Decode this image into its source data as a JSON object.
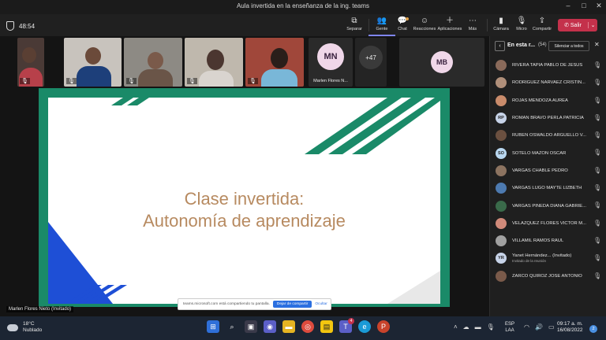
{
  "window": {
    "title": "Aula invertida en la enseñanza de la ing. teams",
    "controls": [
      "–",
      "□",
      "✕"
    ]
  },
  "meeting": {
    "timer": "48:54"
  },
  "toolbar": {
    "separar": "Separar",
    "gente": "Gente",
    "chat": "Chat",
    "reacciones": "Reacciones",
    "aplicaciones": "Aplicaciones",
    "mas": "Más",
    "camara": "Cámara",
    "micro": "Micro",
    "compartir": "Compartir",
    "salir": "Salir"
  },
  "tiles": {
    "mn_initials": "MN",
    "mn_name": "Marlen Flores N...",
    "overflow": "+47",
    "mb_initials": "MB"
  },
  "slide": {
    "title_line1": "Clase invertida:",
    "title_line2": "Autonomía de aprendizaje"
  },
  "sharebar": {
    "message": "teams.microsoft.com está compartiendo tu pantalla.",
    "stop": "Dejar de compartir",
    "hide": "Ocultar"
  },
  "presenter_label": "Marlen Flores Nieto (Invitado)",
  "panel": {
    "title": "En esta r...",
    "count": "(54)",
    "mute_all": "Silenciar a todos",
    "participants": [
      {
        "name": "RIVERA TAPIA PABLO DE JESUS",
        "initials": "",
        "color": "#8a6a5a"
      },
      {
        "name": "RODRIGUEZ NARVAEZ CRISTIN...",
        "initials": "",
        "color": "#b08f7a"
      },
      {
        "name": "ROJAS MENDOZA AUREA",
        "initials": "",
        "color": "#c98b6b"
      },
      {
        "name": "ROMAN BRAVO PERLA PATRICIA",
        "initials": "RP",
        "color": "#c7d3e8"
      },
      {
        "name": "RUBEN OSWALDO ARGUELLO V...",
        "initials": "",
        "color": "#6b5040"
      },
      {
        "name": "SOTELO MAZON OSCAR",
        "initials": "SO",
        "color": "#b9d7f0"
      },
      {
        "name": "VARGAS CHABLE PEDRO",
        "initials": "",
        "color": "#8c7360"
      },
      {
        "name": "VARGAS LUGO MAYTE LIZBETH",
        "initials": "",
        "color": "#4d7ab0"
      },
      {
        "name": "VARGAS PINEDA DIANA GABRIE...",
        "initials": "",
        "color": "#3a6a4a"
      },
      {
        "name": "VELAZQUEZ FLORES VICTOR M...",
        "initials": "",
        "color": "#d08a7a"
      },
      {
        "name": "VILLAMIL RAMOS RAUL",
        "initials": "",
        "color": "#a0a0a0"
      },
      {
        "name": "Yanet Hernández... (Invitado)",
        "initials": "YR",
        "color": "#c7d3e8",
        "sub": "Invitado de la reunión"
      },
      {
        "name": "ZARCO QUIROZ JOSE ANTONIO",
        "initials": "",
        "color": "#7a5a4a"
      }
    ]
  },
  "taskbar": {
    "temp": "18°C",
    "weather": "Nublado",
    "teams_badge": "4",
    "lang1": "ESP",
    "lang2": "LAA",
    "time": "09:17 a. m.",
    "date": "16/08/2022",
    "notif": "2"
  }
}
